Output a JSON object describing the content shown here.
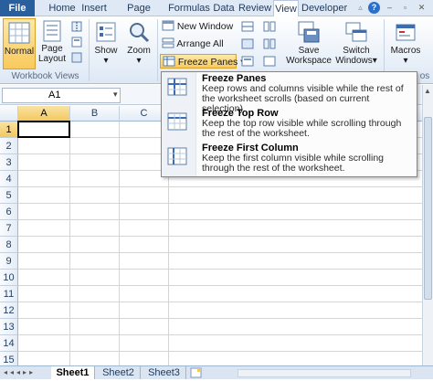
{
  "ribbon_tabs": [
    "File",
    "Home",
    "Insert",
    "Page Layout",
    "Formulas",
    "Data",
    "Review",
    "View",
    "Developer"
  ],
  "ribbon": {
    "normal": "Normal",
    "page_layout_l1": "Page",
    "page_layout_l2": "Layout",
    "show": "Show",
    "zoom": "Zoom",
    "new_window": "New Window",
    "arrange_all": "Arrange All",
    "freeze_panes": "Freeze Panes",
    "save_workspace_l1": "Save",
    "save_workspace_l2": "Workspace",
    "switch_windows_l1": "Switch",
    "switch_windows_l2": "Windows",
    "macros": "Macros",
    "group_workbook_views": "Workbook Views",
    "group_macros_partial": "os"
  },
  "formula_bar": {
    "name_box": "A1"
  },
  "grid": {
    "columns": [
      "A",
      "B",
      "C"
    ],
    "rows": [
      "1",
      "2",
      "3",
      "4",
      "5",
      "6",
      "7",
      "8",
      "9",
      "10",
      "11",
      "12",
      "13",
      "14",
      "15"
    ]
  },
  "sheets": [
    "Sheet1",
    "Sheet2",
    "Sheet3"
  ],
  "freeze_menu": [
    {
      "title": "Freeze Panes",
      "desc": "Keep rows and columns visible while the rest of the worksheet scrolls (based on current selection)."
    },
    {
      "title": "Freeze Top Row",
      "desc": "Keep the top row visible while scrolling through the rest of the worksheet."
    },
    {
      "title": "Freeze First Column",
      "desc": "Keep the first column visible while scrolling through the rest of the worksheet."
    }
  ],
  "colors": {
    "file_tab": "#2a5f9e",
    "selected_header": "#f3c760",
    "highlight": "#fbe29a"
  }
}
